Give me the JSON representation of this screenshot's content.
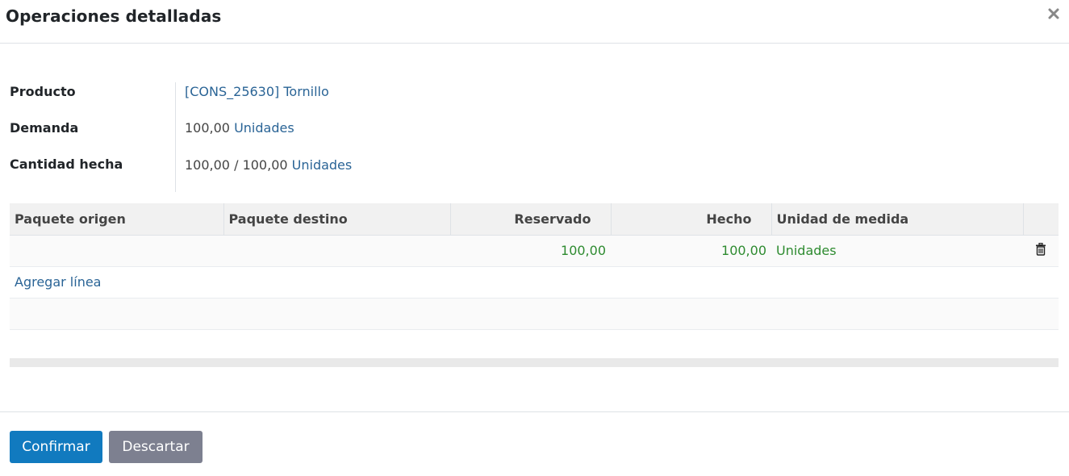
{
  "dialog": {
    "title": "Operaciones detalladas",
    "close_icon": "close-icon"
  },
  "form": {
    "product_label": "Producto",
    "product_value": "[CONS_25630] Tornillo",
    "demand_label": "Demanda",
    "demand_qty": "100,00",
    "demand_uom": "Unidades",
    "done_label": "Cantidad hecha",
    "done_qty": "100,00",
    "done_sep": "/",
    "done_total": "100,00",
    "done_uom": "Unidades"
  },
  "table": {
    "headers": [
      "Paquete origen",
      "Paquete destino",
      "Reservado",
      "Hecho",
      "Unidad de medida"
    ],
    "rows": [
      {
        "source_package": "",
        "dest_package": "",
        "reserved": "100,00",
        "done": "100,00",
        "uom": "Unidades",
        "delete_icon": "trash-icon"
      }
    ],
    "add_line": "Agregar línea"
  },
  "footer": {
    "confirm_label": "Confirmar",
    "discard_label": "Descartar"
  },
  "colors": {
    "primary": "#117abf",
    "secondary": "#7d8090",
    "link": "#2a6496",
    "quantity": "#2e8b30"
  }
}
